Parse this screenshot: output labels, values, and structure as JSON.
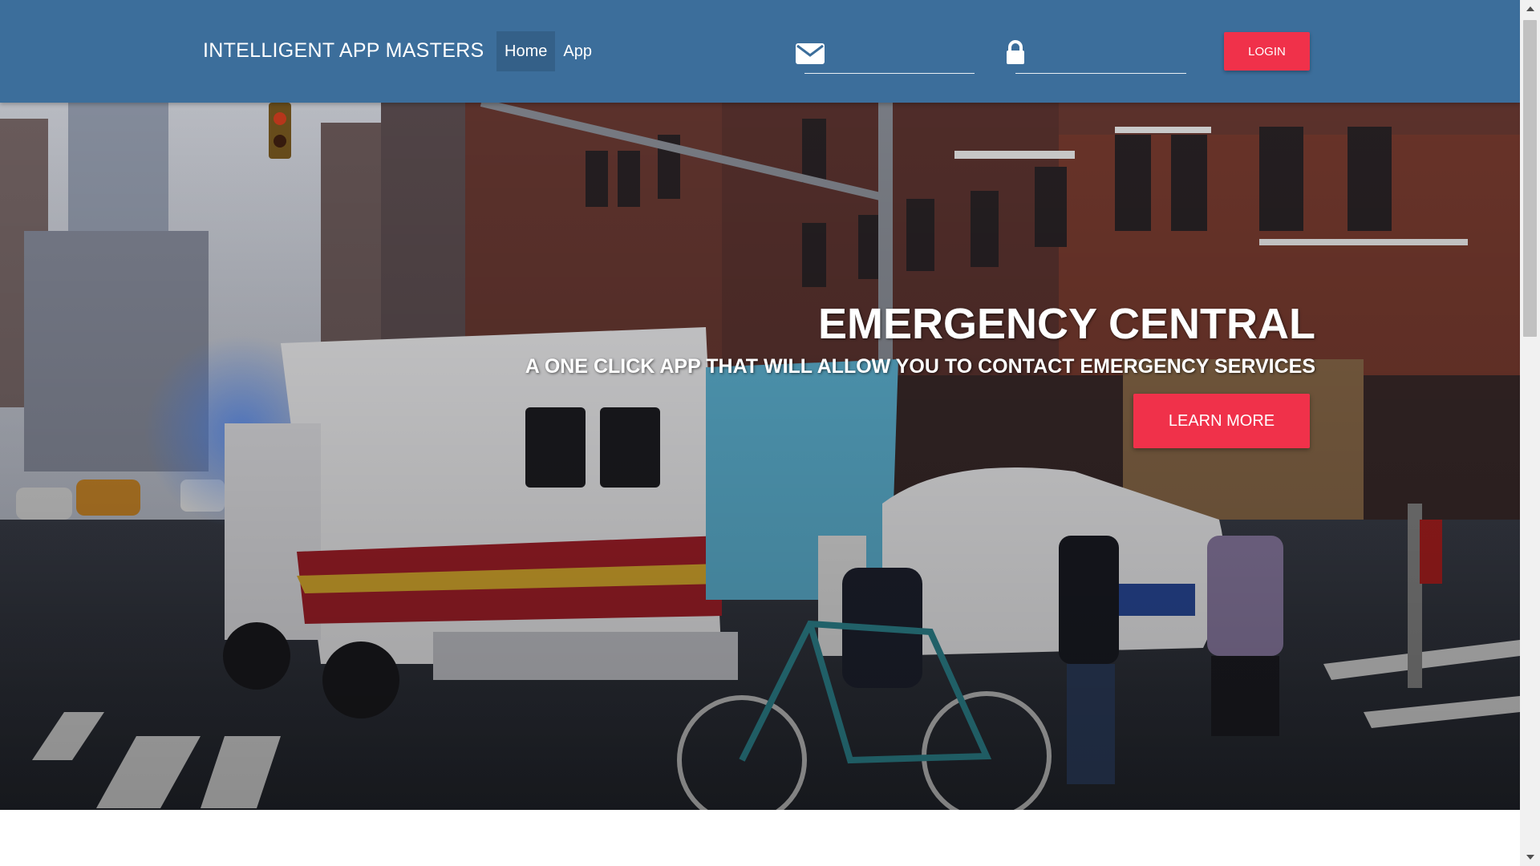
{
  "navbar": {
    "brand": "INTELLIGENT APP MASTERS",
    "links": [
      {
        "label": "Home",
        "active": true
      },
      {
        "label": "App",
        "active": false
      }
    ],
    "email_field": {
      "icon": "envelope-icon",
      "value": ""
    },
    "password_field": {
      "icon": "lock-icon",
      "value": ""
    },
    "login_label": "LOGIN"
  },
  "hero": {
    "title": "EMERGENCY CENTRAL",
    "subtitle": "A ONE CLICK APP THAT WILL ALLOW YOU TO CONTACT EMERGENCY SERVICES",
    "button_label": "LEARN MORE",
    "background": "city street photo with FDNY ambulance, police car, cyclist and pedestrians"
  },
  "colors": {
    "navbar": "#3c6e9b",
    "accent": "#f0314a",
    "text": "#ffffff"
  }
}
